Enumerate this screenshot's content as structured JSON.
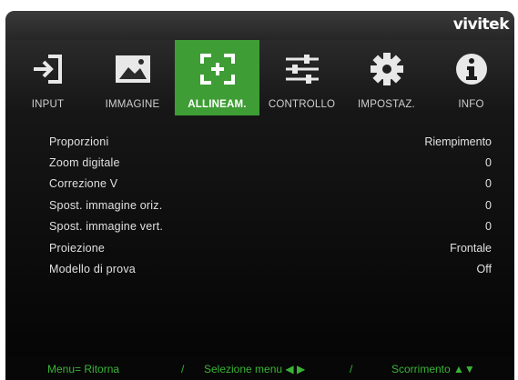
{
  "brand": "vivitek",
  "tabs": [
    {
      "label": "INPUT",
      "icon": "input-icon",
      "active": false
    },
    {
      "label": "IMMAGINE",
      "icon": "picture-icon",
      "active": false
    },
    {
      "label": "ALLINEAM.",
      "icon": "alignment-icon",
      "active": true
    },
    {
      "label": "CONTROLLO",
      "icon": "sliders-icon",
      "active": false
    },
    {
      "label": "IMPOSTAZ.",
      "icon": "gear-icon",
      "active": false
    },
    {
      "label": "INFO",
      "icon": "info-icon",
      "active": false
    }
  ],
  "menu": [
    {
      "name": "Proporzioni",
      "value": "Riempimento"
    },
    {
      "name": "Zoom digitale",
      "value": "0"
    },
    {
      "name": "Correzione V",
      "value": "0"
    },
    {
      "name": "Spost. immagine oriz.",
      "value": "0"
    },
    {
      "name": "Spost. immagine vert.",
      "value": "0"
    },
    {
      "name": "Proiezione",
      "value": "Frontale"
    },
    {
      "name": "Modello di prova",
      "value": "Off"
    }
  ],
  "footer": {
    "menu_hint": "Menu= Ritorna",
    "sep1": "/",
    "select_hint": "Selezione menu ◀ ▶",
    "sep2": "/",
    "scroll_hint": "Scorrimento ▲▼"
  },
  "colors": {
    "accent": "#3e9d35",
    "footer_text": "#39b336"
  }
}
